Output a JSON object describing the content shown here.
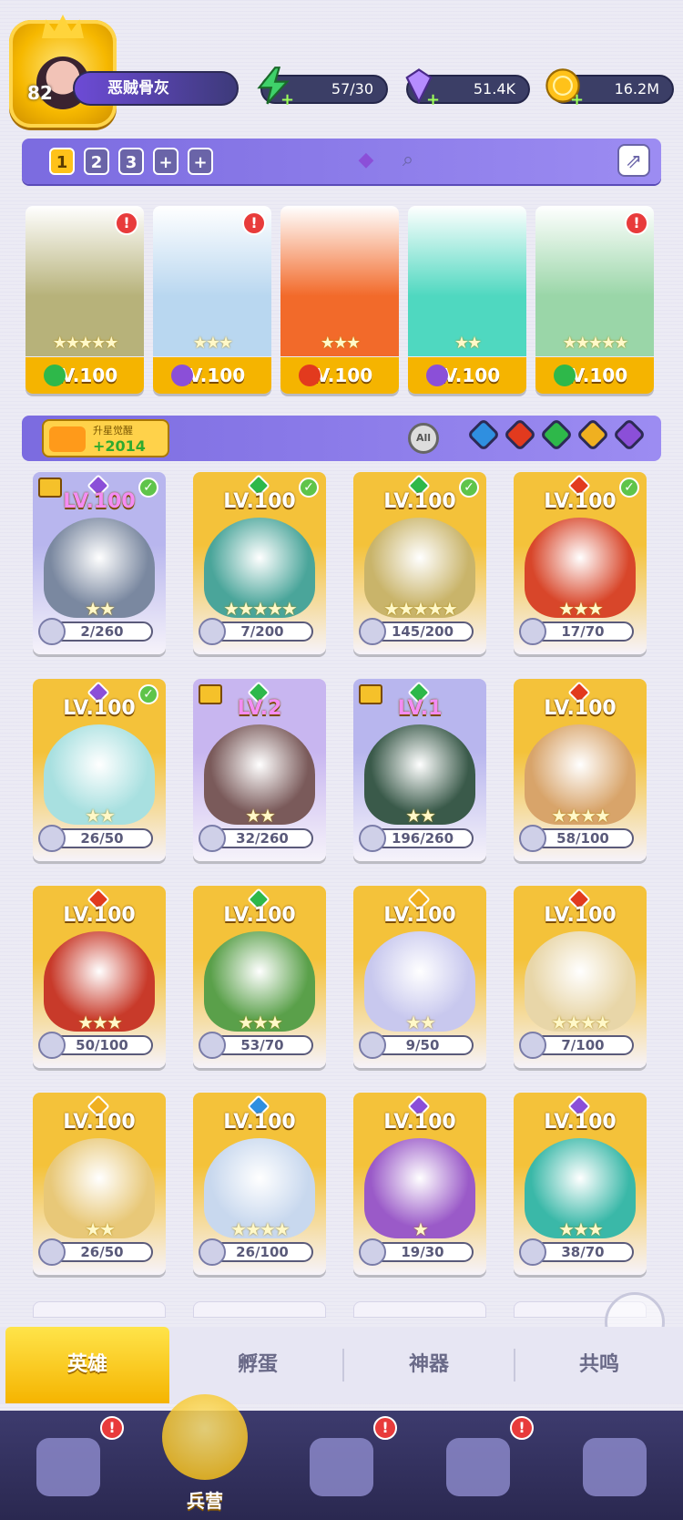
{
  "player": {
    "level": "82",
    "name": "恶贼骨灰"
  },
  "resources": [
    {
      "id": "energy",
      "value": "57/30",
      "icon": "lightning-icon",
      "color": "#3fd16a"
    },
    {
      "id": "gems",
      "value": "51.4K",
      "icon": "diamond-icon",
      "color": "#b58cff"
    },
    {
      "id": "gold",
      "value": "16.2M",
      "icon": "coin-icon",
      "color": "#ffc21a"
    }
  ],
  "team_tabs": [
    "1",
    "2",
    "3",
    "+",
    "+"
  ],
  "team_heroes": [
    {
      "level": "LV.100",
      "stars": "★★★★★",
      "element": "#2eb84a",
      "alert": "!",
      "art": "#b7b27a"
    },
    {
      "level": "LV.100",
      "stars": "★★★",
      "element": "#8b4fd8",
      "alert": "!",
      "art": "#b9d7f0"
    },
    {
      "level": "LV.100",
      "stars": "★★★",
      "element": "#e23a1e",
      "alert": "",
      "art": "#f26a2a"
    },
    {
      "level": "LV.100",
      "stars": "★★",
      "element": "#8b4fd8",
      "alert": "",
      "art": "#4fd8c0"
    },
    {
      "level": "LV.100",
      "stars": "★★★★★",
      "element": "#2eb84a",
      "alert": "!",
      "art": "#9ad6a8"
    }
  ],
  "upgrade": {
    "label": "升星觉醒",
    "value": "+2014"
  },
  "filters": {
    "all_label": "All",
    "elements": [
      {
        "name": "water-element",
        "color": "#2f8fe0"
      },
      {
        "name": "fire-element",
        "color": "#e23a1e"
      },
      {
        "name": "nature-element",
        "color": "#2eb84a"
      },
      {
        "name": "light-element",
        "color": "#f0b020"
      },
      {
        "name": "dark-element",
        "color": "#8b4fd8"
      }
    ]
  },
  "heroes": [
    {
      "level": "LV.100",
      "low": true,
      "progress": "2/260",
      "stars": "★★",
      "gem": "#8b4fd8",
      "check": true,
      "armor": true,
      "bg": "#b8b6ee",
      "art": "#7a88a0"
    },
    {
      "level": "LV.100",
      "low": false,
      "progress": "7/200",
      "stars": "★★★★★",
      "gem": "#2eb84a",
      "check": true,
      "armor": false,
      "bg": "#f4c23a",
      "art": "#4aa59a"
    },
    {
      "level": "LV.100",
      "low": false,
      "progress": "145/200",
      "stars": "★★★★★",
      "gem": "#2eb84a",
      "check": true,
      "armor": false,
      "bg": "#f4c23a",
      "art": "#c9b46a"
    },
    {
      "level": "LV.100",
      "low": false,
      "progress": "17/70",
      "stars": "★★★",
      "gem": "#e23a1e",
      "check": true,
      "armor": false,
      "bg": "#f4c23a",
      "art": "#d8462a"
    },
    {
      "level": "LV.100",
      "low": false,
      "progress": "26/50",
      "stars": "★★",
      "gem": "#8b4fd8",
      "check": true,
      "armor": false,
      "bg": "#f4c23a",
      "art": "#a8e0e0"
    },
    {
      "level": "LV.2",
      "low": true,
      "progress": "32/260",
      "stars": "★★",
      "gem": "#2eb84a",
      "check": false,
      "armor": true,
      "bg": "#c8b6f0",
      "art": "#7a5a5a"
    },
    {
      "level": "LV.1",
      "low": true,
      "progress": "196/260",
      "stars": "★★",
      "gem": "#2eb84a",
      "check": false,
      "armor": true,
      "bg": "#b8b6ee",
      "art": "#3a5a4a"
    },
    {
      "level": "LV.100",
      "low": false,
      "progress": "58/100",
      "stars": "★★★★",
      "gem": "#e23a1e",
      "check": false,
      "armor": false,
      "bg": "#f4c23a",
      "art": "#d8a46a"
    },
    {
      "level": "LV.100",
      "low": false,
      "progress": "50/100",
      "stars": "★★★",
      "gem": "#e23a1e",
      "check": false,
      "armor": false,
      "bg": "#f4c23a",
      "art": "#c83a2a"
    },
    {
      "level": "LV.100",
      "low": false,
      "progress": "53/70",
      "stars": "★★★",
      "gem": "#2eb84a",
      "check": false,
      "armor": false,
      "bg": "#f4c23a",
      "art": "#5aa04a"
    },
    {
      "level": "LV.100",
      "low": false,
      "progress": "9/50",
      "stars": "★★",
      "gem": "#f0b020",
      "check": false,
      "armor": false,
      "bg": "#f4c23a",
      "art": "#c8c8ee"
    },
    {
      "level": "LV.100",
      "low": false,
      "progress": "7/100",
      "stars": "★★★★",
      "gem": "#e23a1e",
      "check": false,
      "armor": false,
      "bg": "#f4c23a",
      "art": "#e8d6a8"
    },
    {
      "level": "LV.100",
      "low": false,
      "progress": "26/50",
      "stars": "★★",
      "gem": "#f0b020",
      "check": false,
      "armor": false,
      "bg": "#f4c23a",
      "art": "#e8c878"
    },
    {
      "level": "LV.100",
      "low": false,
      "progress": "26/100",
      "stars": "★★★★",
      "gem": "#2f8fe0",
      "check": false,
      "armor": false,
      "bg": "#f4c23a",
      "art": "#c8d8ee"
    },
    {
      "level": "LV.100",
      "low": false,
      "progress": "19/30",
      "stars": "★",
      "gem": "#8b4fd8",
      "check": false,
      "armor": false,
      "bg": "#f4c23a",
      "art": "#9a5ac8"
    },
    {
      "level": "LV.100",
      "low": false,
      "progress": "38/70",
      "stars": "★★★",
      "gem": "#8b4fd8",
      "check": false,
      "armor": false,
      "bg": "#f4c23a",
      "art": "#3ab8a8"
    }
  ],
  "subtabs": [
    "英雄",
    "孵蛋",
    "神器",
    "共鸣"
  ],
  "nav": [
    {
      "id": "cards",
      "label": "",
      "alert": "!"
    },
    {
      "id": "barracks",
      "label": "兵营",
      "alert": ""
    },
    {
      "id": "book",
      "label": "",
      "alert": "!"
    },
    {
      "id": "shop",
      "label": "",
      "alert": "!"
    },
    {
      "id": "guild",
      "label": "",
      "alert": ""
    }
  ]
}
